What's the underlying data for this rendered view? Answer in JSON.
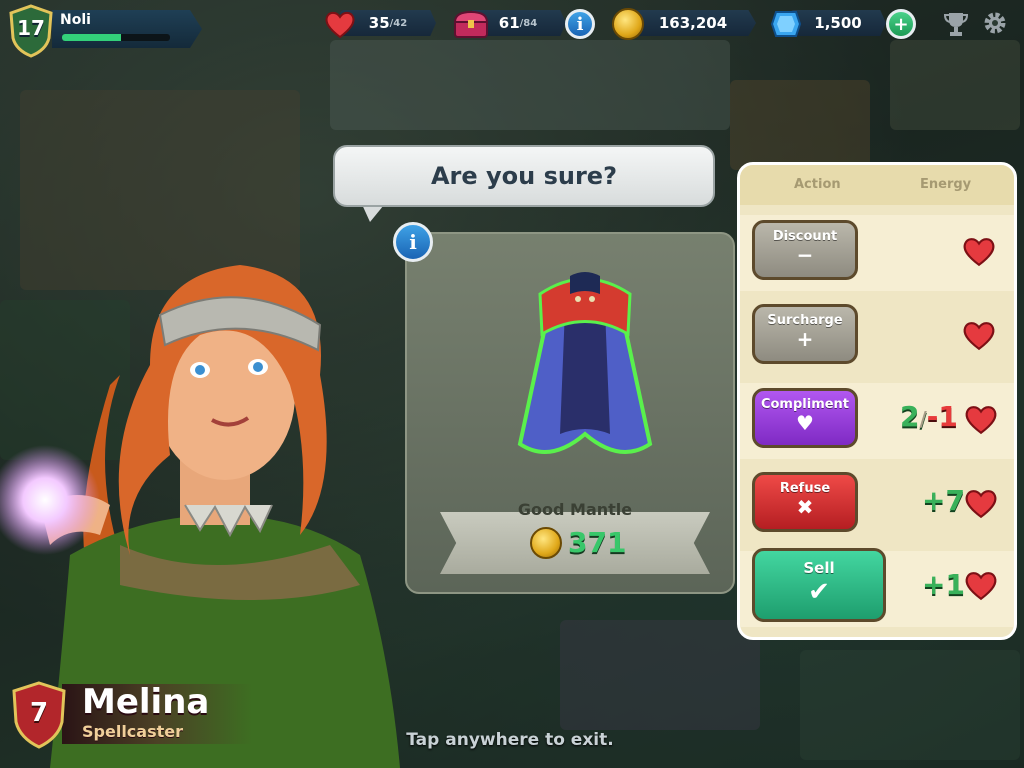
{
  "player": {
    "level": "17",
    "name": "Noli",
    "xp_progress": 0.55
  },
  "resources": {
    "energy": {
      "value": "35",
      "max": "/42",
      "icon": "heart-icon"
    },
    "chest": {
      "value": "61",
      "max": "/84",
      "icon": "chest-icon"
    },
    "gold": {
      "value": "163,204",
      "icon": "coin-icon"
    },
    "gems": {
      "value": "1,500",
      "icon": "gem-icon"
    }
  },
  "dialog": {
    "prompt": "Are you sure?"
  },
  "item": {
    "name": "Good Mantle",
    "price": "371"
  },
  "actions": {
    "header_action": "Action",
    "header_energy": "Energy",
    "rows": [
      {
        "label": "Discount",
        "symbol": "−"
      },
      {
        "label": "Surcharge",
        "symbol": "+"
      },
      {
        "label": "Compliment",
        "symbol": "♥",
        "energy_a": "2",
        "energy_sep": "/",
        "energy_b": "-1"
      },
      {
        "label": "Refuse",
        "symbol": "✖",
        "energy": "+7"
      },
      {
        "label": "Sell",
        "symbol": "✔",
        "energy": "+1"
      }
    ]
  },
  "customer": {
    "level": "7",
    "name": "Melina",
    "class": "Spellcaster"
  },
  "footer": {
    "exit_hint": "Tap anywhere to exit."
  },
  "colors": {
    "gold_green": "#39c76a",
    "sell_green": "#2cbd86",
    "refuse_red": "#d8322f",
    "compliment_purple": "#9a3fe0"
  }
}
